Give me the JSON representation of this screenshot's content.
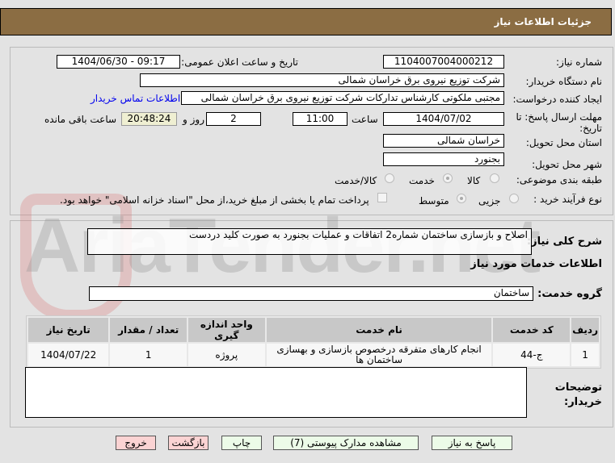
{
  "header": {
    "title": "جزئیات اطلاعات نیاز"
  },
  "fields": {
    "need_number_label": "شماره نیاز:",
    "need_number": "1104007004000212",
    "announce_label": "تاریخ و ساعت اعلان عمومی:",
    "announce_value": "1404/06/30 - 09:17",
    "buyer_label": "نام دستگاه خریدار:",
    "buyer": "شرکت توزیع نیروی برق خراسان شمالی",
    "creator_label": "ایجاد کننده درخواست:",
    "creator": "مجتبی ملکوتی کارشناس تدارکات شرکت توزیع نیروی برق خراسان شمالی",
    "contact_link": "اطلاعات تماس خریدار",
    "deadline_label": "مهلت ارسال پاسخ: تا تاریخ:",
    "deadline_date": "1404/07/02",
    "time_label": "ساعت",
    "deadline_time": "11:00",
    "days": "2",
    "days_label": "روز و",
    "remaining": "20:48:24",
    "remaining_label": "ساعت باقی مانده",
    "province_label": "استان محل تحویل:",
    "province": "خراسان شمالی",
    "city_label": "شهر محل تحویل:",
    "city": "بجنورد",
    "category_label": "طبقه بندی موضوعی:",
    "category_options": [
      {
        "label": "کالا",
        "selected": false
      },
      {
        "label": "خدمت",
        "selected": true
      },
      {
        "label": "کالا/خدمت",
        "selected": false
      }
    ],
    "process_label": "نوع فرآیند خرید :",
    "process_options": [
      {
        "label": "جزیی",
        "selected": false
      },
      {
        "label": "متوسط",
        "selected": true
      }
    ],
    "payment_note": "پرداخت تمام یا بخشی از مبلغ خرید،از محل \"اسناد خزانه اسلامی\" خواهد بود.",
    "payment_checked": false
  },
  "details": {
    "summary_label": "شرح کلی نیاز:",
    "summary": "اصلاح و بازسازی ساختمان شماره2 اتفاقات و عملیات بجنورد به صورت کلید دردست",
    "services_title": "اطلاعات خدمات مورد نیاز",
    "group_label": "گروه خدمت:",
    "group": "ساختمان",
    "table": {
      "headers": [
        "ردیف",
        "کد خدمت",
        "نام خدمت",
        "واحد اندازه گیری",
        "تعداد / مقدار",
        "تاریخ نیاز"
      ],
      "rows": [
        [
          "1",
          "ج-44",
          "انجام کارهای متفرقه درخصوص بازسازی و بهسازی ساختمان ها",
          "پروژه",
          "1",
          "1404/07/22"
        ]
      ]
    },
    "buyer_notes_label": "توضیحات خریدار:",
    "buyer_notes": ""
  },
  "buttons": {
    "reply": "پاسخ به نیاز",
    "attachments": "مشاهده مدارک پیوستی (7)",
    "print": "چاپ",
    "back": "بازگشت",
    "exit": "خروج"
  },
  "watermark": "AriaTender.net",
  "colors": {
    "header": "#8b6d43",
    "link": "#0000ee",
    "green_button": "#ecfbe8",
    "pink_button": "#fbd3d3",
    "remaining_bg": "#efefd2"
  }
}
